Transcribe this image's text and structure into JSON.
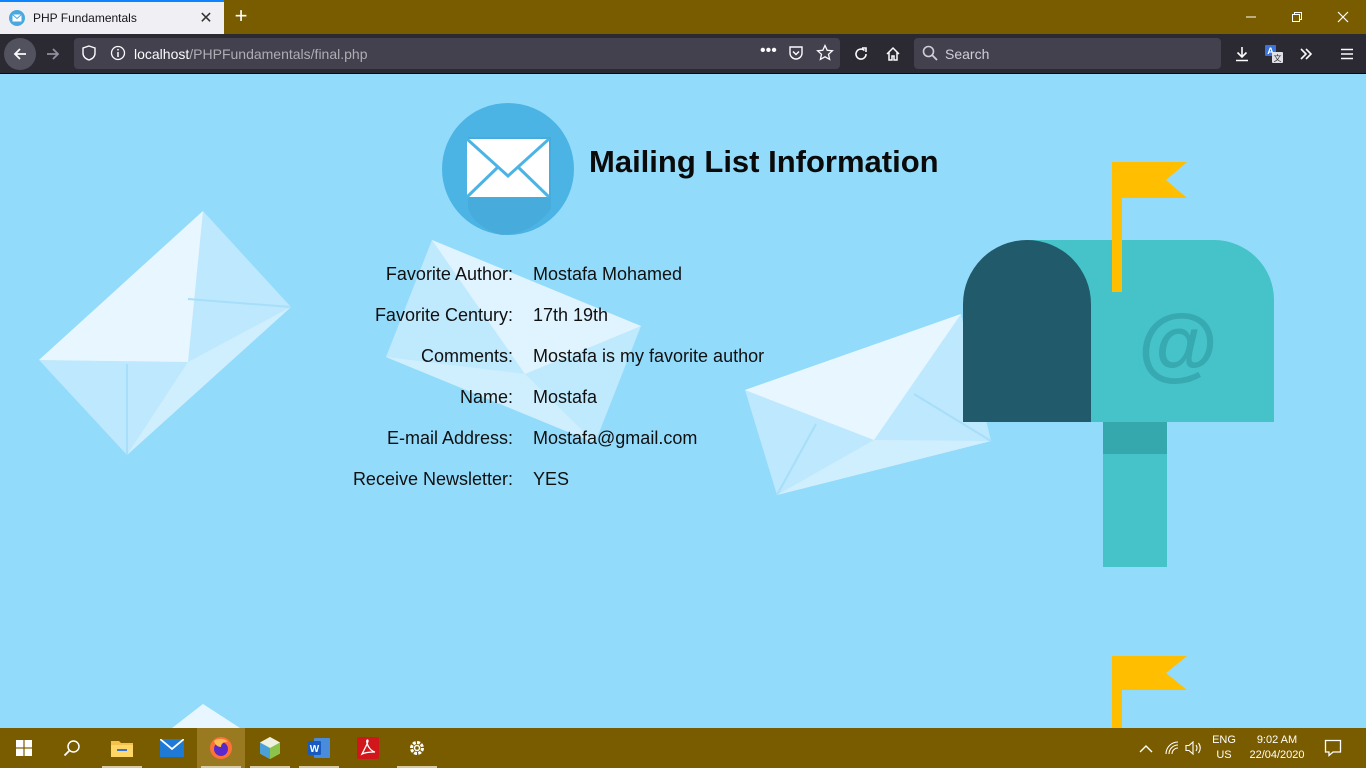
{
  "browser": {
    "tab_title": "PHP Fundamentals",
    "url_host": "localhost",
    "url_path": "/PHPFundamentals/final.php",
    "search_placeholder": "Search",
    "new_tab": "+"
  },
  "page": {
    "title": "Mailing List Information",
    "mailbox_symbol": "@",
    "fields": [
      {
        "label": "Favorite Author:",
        "value": "Mostafa Mohamed"
      },
      {
        "label": "Favorite Century:",
        "value": "17th 19th"
      },
      {
        "label": "Comments:",
        "value": "Mostafa is my favorite author"
      },
      {
        "label": "Name:",
        "value": "Mostafa"
      },
      {
        "label": "E-mail Address:",
        "value": "Mostafa@gmail.com"
      },
      {
        "label": "Receive Newsletter:",
        "value": "YES"
      }
    ]
  },
  "taskbar": {
    "lang_top": "ENG",
    "lang_bottom": "US",
    "time": "9:02 AM",
    "date": "22/04/2020"
  },
  "colors": {
    "page_bg": "#93dbfb",
    "chrome_bg": "#7a5c00",
    "mailbox_teal": "#45c3c8",
    "mailbox_dark": "#215a6b",
    "flag_yellow": "#ffbf00"
  }
}
